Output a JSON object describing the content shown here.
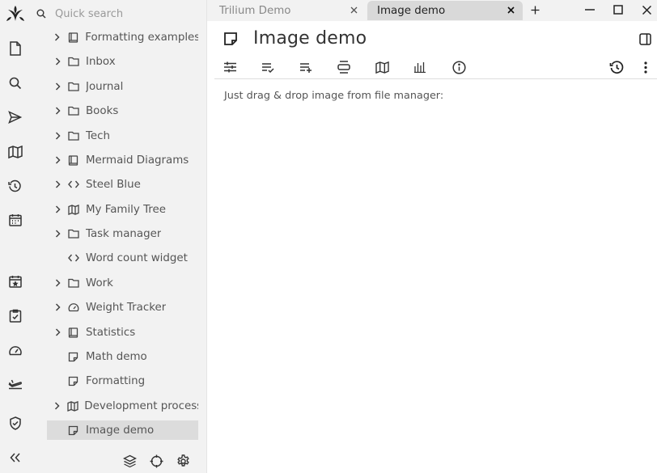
{
  "window": {
    "tabs": [
      {
        "label": "Trilium Demo",
        "active": false
      },
      {
        "label": "Image demo",
        "active": true
      }
    ],
    "new_tab_icon": "plus-icon",
    "controls": [
      "minimize-icon",
      "maximize-icon",
      "close-icon"
    ]
  },
  "launcher": {
    "logo": "trilium-logo",
    "items": [
      "new-note-icon",
      "search-icon",
      "jump-to-note-icon",
      "note-map-icon",
      "recent-changes-icon",
      "calendar-icon",
      "today-icon",
      "task-icon",
      "dashboard-icon",
      "travel-icon",
      "protected-session-icon"
    ],
    "collapse_icon": "collapse-sidebar-icon"
  },
  "tree": {
    "search": {
      "placeholder": "Quick search"
    },
    "nodes": [
      {
        "label": "Formatting examples",
        "icon": "book-icon",
        "expandable": true
      },
      {
        "label": "Inbox",
        "icon": "folder-icon",
        "expandable": true
      },
      {
        "label": "Journal",
        "icon": "folder-icon",
        "expandable": true
      },
      {
        "label": "Books",
        "icon": "folder-icon",
        "expandable": true
      },
      {
        "label": "Tech",
        "icon": "folder-icon",
        "expandable": true
      },
      {
        "label": "Mermaid Diagrams",
        "icon": "book-icon",
        "expandable": true
      },
      {
        "label": "Steel Blue",
        "icon": "code-icon",
        "expandable": true
      },
      {
        "label": "My Family Tree",
        "icon": "map-icon",
        "expandable": true
      },
      {
        "label": "Task manager",
        "icon": "folder-icon",
        "expandable": true
      },
      {
        "label": "Word count widget",
        "icon": "code-icon",
        "expandable": false
      },
      {
        "label": "Work",
        "icon": "folder-icon",
        "expandable": true
      },
      {
        "label": "Weight Tracker",
        "icon": "gauge-icon",
        "expandable": true
      },
      {
        "label": "Statistics",
        "icon": "book-icon",
        "expandable": true
      },
      {
        "label": "Math demo",
        "icon": "note-icon",
        "expandable": false
      },
      {
        "label": "Formatting",
        "icon": "note-icon",
        "expandable": false
      },
      {
        "label": "Development process",
        "icon": "map-icon",
        "expandable": true
      },
      {
        "label": "Image demo",
        "icon": "note-icon",
        "expandable": false,
        "active": true
      }
    ],
    "footer": [
      "layers-icon",
      "locate-note-icon",
      "tree-settings-icon"
    ]
  },
  "note": {
    "title": "Image demo",
    "ribbon_left": [
      "note-properties-icon",
      "owned-attributes-icon",
      "inherited-attributes-icon",
      "promoted-attributes-icon",
      "note-map-icon",
      "note-info-chart-icon",
      "info-icon"
    ],
    "ribbon_right": [
      "note-revisions-icon",
      "more-menu-icon"
    ],
    "content": "Just drag & drop image from file manager:"
  }
}
